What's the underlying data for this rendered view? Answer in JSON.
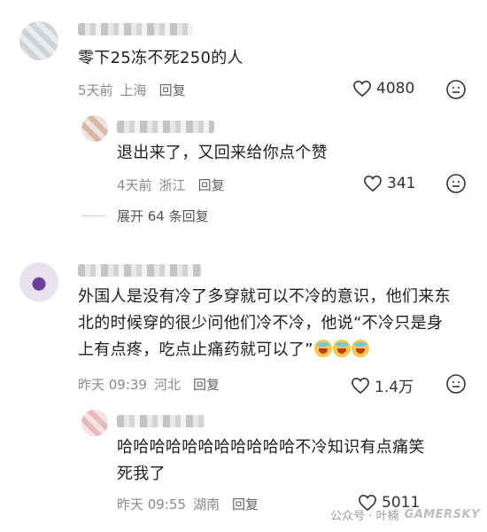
{
  "comments": [
    {
      "text": "零下25冻不死250的人",
      "date": "5天前",
      "location": "上海",
      "reply_label": "回复",
      "likes": "4080",
      "expand": "展开 64 条回复",
      "reply": {
        "text": "退出来了，又回来给你点个赞",
        "date": "4天前",
        "location": "浙江",
        "reply_label": "回复",
        "likes": "341"
      }
    },
    {
      "text_lines": [
        "外国人是没有冷了多穿就可以不冷的意识，他们来东",
        "北的时候穿的很少问他们冷不冷，他说“不冷只是身",
        "上有点疼，吃点止痛药就可以了”"
      ],
      "date": "昨天 09:39",
      "location": "河北",
      "reply_label": "回复",
      "likes": "1.4万",
      "reply": {
        "text_lines": [
          "哈哈哈哈哈哈哈哈哈哈哈不冷知识有点痛笑",
          "死我了"
        ],
        "date": "昨天 09:55",
        "location": "湖南",
        "reply_label": "回复",
        "likes": "5011"
      }
    }
  ],
  "watermark": {
    "source": "公众号 · 叶楠",
    "logo": "GAMERSKY"
  }
}
